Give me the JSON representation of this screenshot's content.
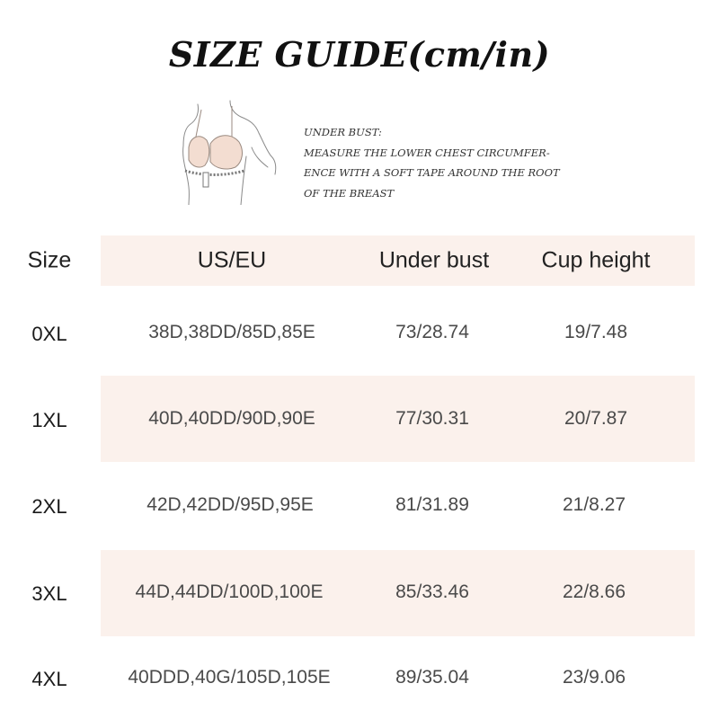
{
  "title": "SIZE GUIDE(cm/in)",
  "measure_note": {
    "lines": [
      "UNDER BUST:",
      "MEASURE THE LOWER CHEST CIRCUMFER-",
      "ENCE WITH A SOFT TAPE AROUND THE ROOT",
      "OF THE BREAST"
    ]
  },
  "table": {
    "headers": [
      "Size",
      "US/EU",
      "Under bust",
      "Cup height"
    ],
    "rows": [
      {
        "size": "0XL",
        "us_eu": "38D,38DD/85D,85E",
        "under_bust": "73/28.74",
        "cup_height": "19/7.48"
      },
      {
        "size": "1XL",
        "us_eu": "40D,40DD/90D,90E",
        "under_bust": "77/30.31",
        "cup_height": "20/7.87"
      },
      {
        "size": "2XL",
        "us_eu": "42D,42DD/95D,95E",
        "under_bust": "81/31.89",
        "cup_height": "21/8.27"
      },
      {
        "size": "3XL",
        "us_eu": "44D,44DD/100D,100E",
        "under_bust": "85/33.46",
        "cup_height": "22/8.66"
      },
      {
        "size": "4XL",
        "us_eu": "40DDD,40G/105D,105E",
        "under_bust": "89/35.04",
        "cup_height": "23/9.06"
      }
    ]
  },
  "colors": {
    "band": "#fbf1ec",
    "title": "#111111",
    "value_text": "#4a4a4a"
  }
}
